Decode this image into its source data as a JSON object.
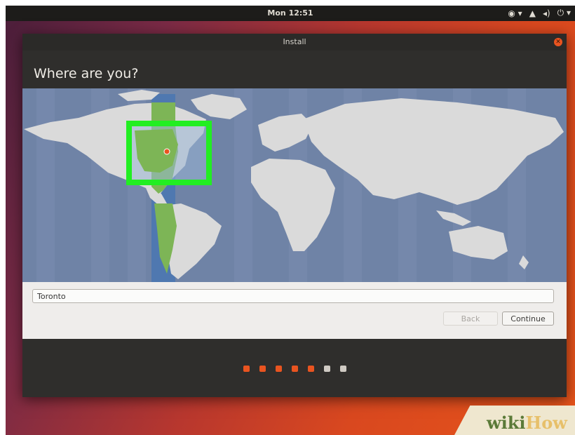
{
  "topbar": {
    "clock": "Mon 12:51",
    "icons": [
      "accessibility-icon",
      "network-icon",
      "volume-icon",
      "power-icon"
    ]
  },
  "window": {
    "title": "Install",
    "heading": "Where are you?"
  },
  "location": {
    "value": "Toronto"
  },
  "buttons": {
    "back": "Back",
    "continue": "Continue"
  },
  "progress": {
    "total_steps": 7,
    "completed_steps": 5,
    "done_color": "#e95420",
    "pending_color": "#cfcac3"
  },
  "highlight_color": "#22ee22",
  "watermark": {
    "part1": "wiki",
    "part2": "How"
  }
}
